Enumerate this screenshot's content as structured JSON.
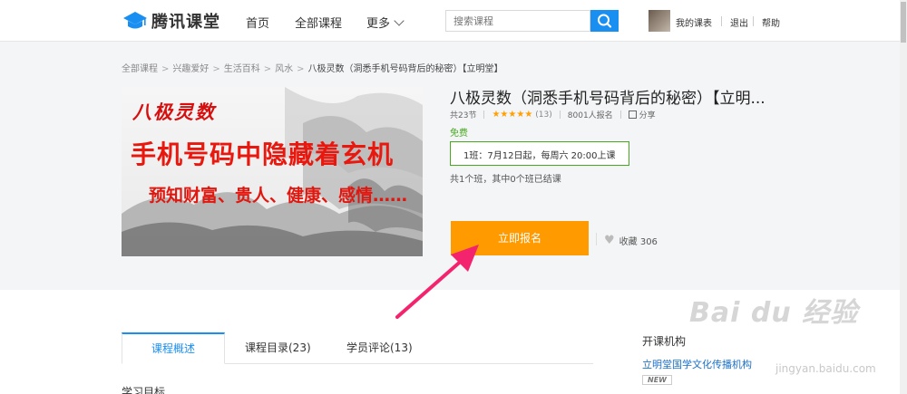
{
  "header": {
    "logo_text": "腾讯课堂",
    "nav": {
      "home": "首页",
      "all_courses": "全部课程",
      "more": "更多"
    },
    "search_placeholder": "搜索课程",
    "my_schedule": "我的课表",
    "logout": "退出",
    "help": "帮助"
  },
  "breadcrumb": [
    "全部课程",
    "兴趣爱好",
    "生活百科",
    "风水",
    "八极灵数（洞悉手机号码背后的秘密）【立明堂】"
  ],
  "breadcrumb_sep": ">",
  "cover": {
    "line1": "八极灵数",
    "line2": "手机号码中隐藏着玄机",
    "line3": "预知财富、贵人、健康、感情……"
  },
  "course": {
    "title": "八极灵数（洞悉手机号码背后的秘密）【立明...",
    "lessons": "共23节",
    "rating_stars": 4.5,
    "rating_count": "(13)",
    "enrolled": "8001人报名",
    "share": "分享",
    "price": "免费",
    "class_info": "1班：7月12日起，每周六 20:00上课",
    "class_note": "共1个班，其中0个班已结课",
    "enroll_button": "立即报名",
    "favorite": "收藏 306"
  },
  "tabs": [
    {
      "label": "课程概述",
      "active": true
    },
    {
      "label": "课程目录(23)",
      "active": false
    },
    {
      "label": "学员评论(13)",
      "active": false
    }
  ],
  "section_title": "学习目标",
  "sidebar": {
    "org_label": "开课机构",
    "org_name": "立明堂国学文化传播机构",
    "badge": "NEW"
  },
  "watermark": {
    "text": "Bai du 经验",
    "sub": "jingyan.baidu.com"
  },
  "colors": {
    "accent": "#1a8ff2",
    "enroll": "#ff9a00",
    "free_green": "#46a91e",
    "star": "#ff9f00",
    "arrow": "#f4236d"
  },
  "icons": [
    "graduation-cap-icon",
    "chevron-down-icon",
    "search-icon",
    "star-icon",
    "share-icon",
    "heart-icon",
    "arrow-annotation"
  ]
}
